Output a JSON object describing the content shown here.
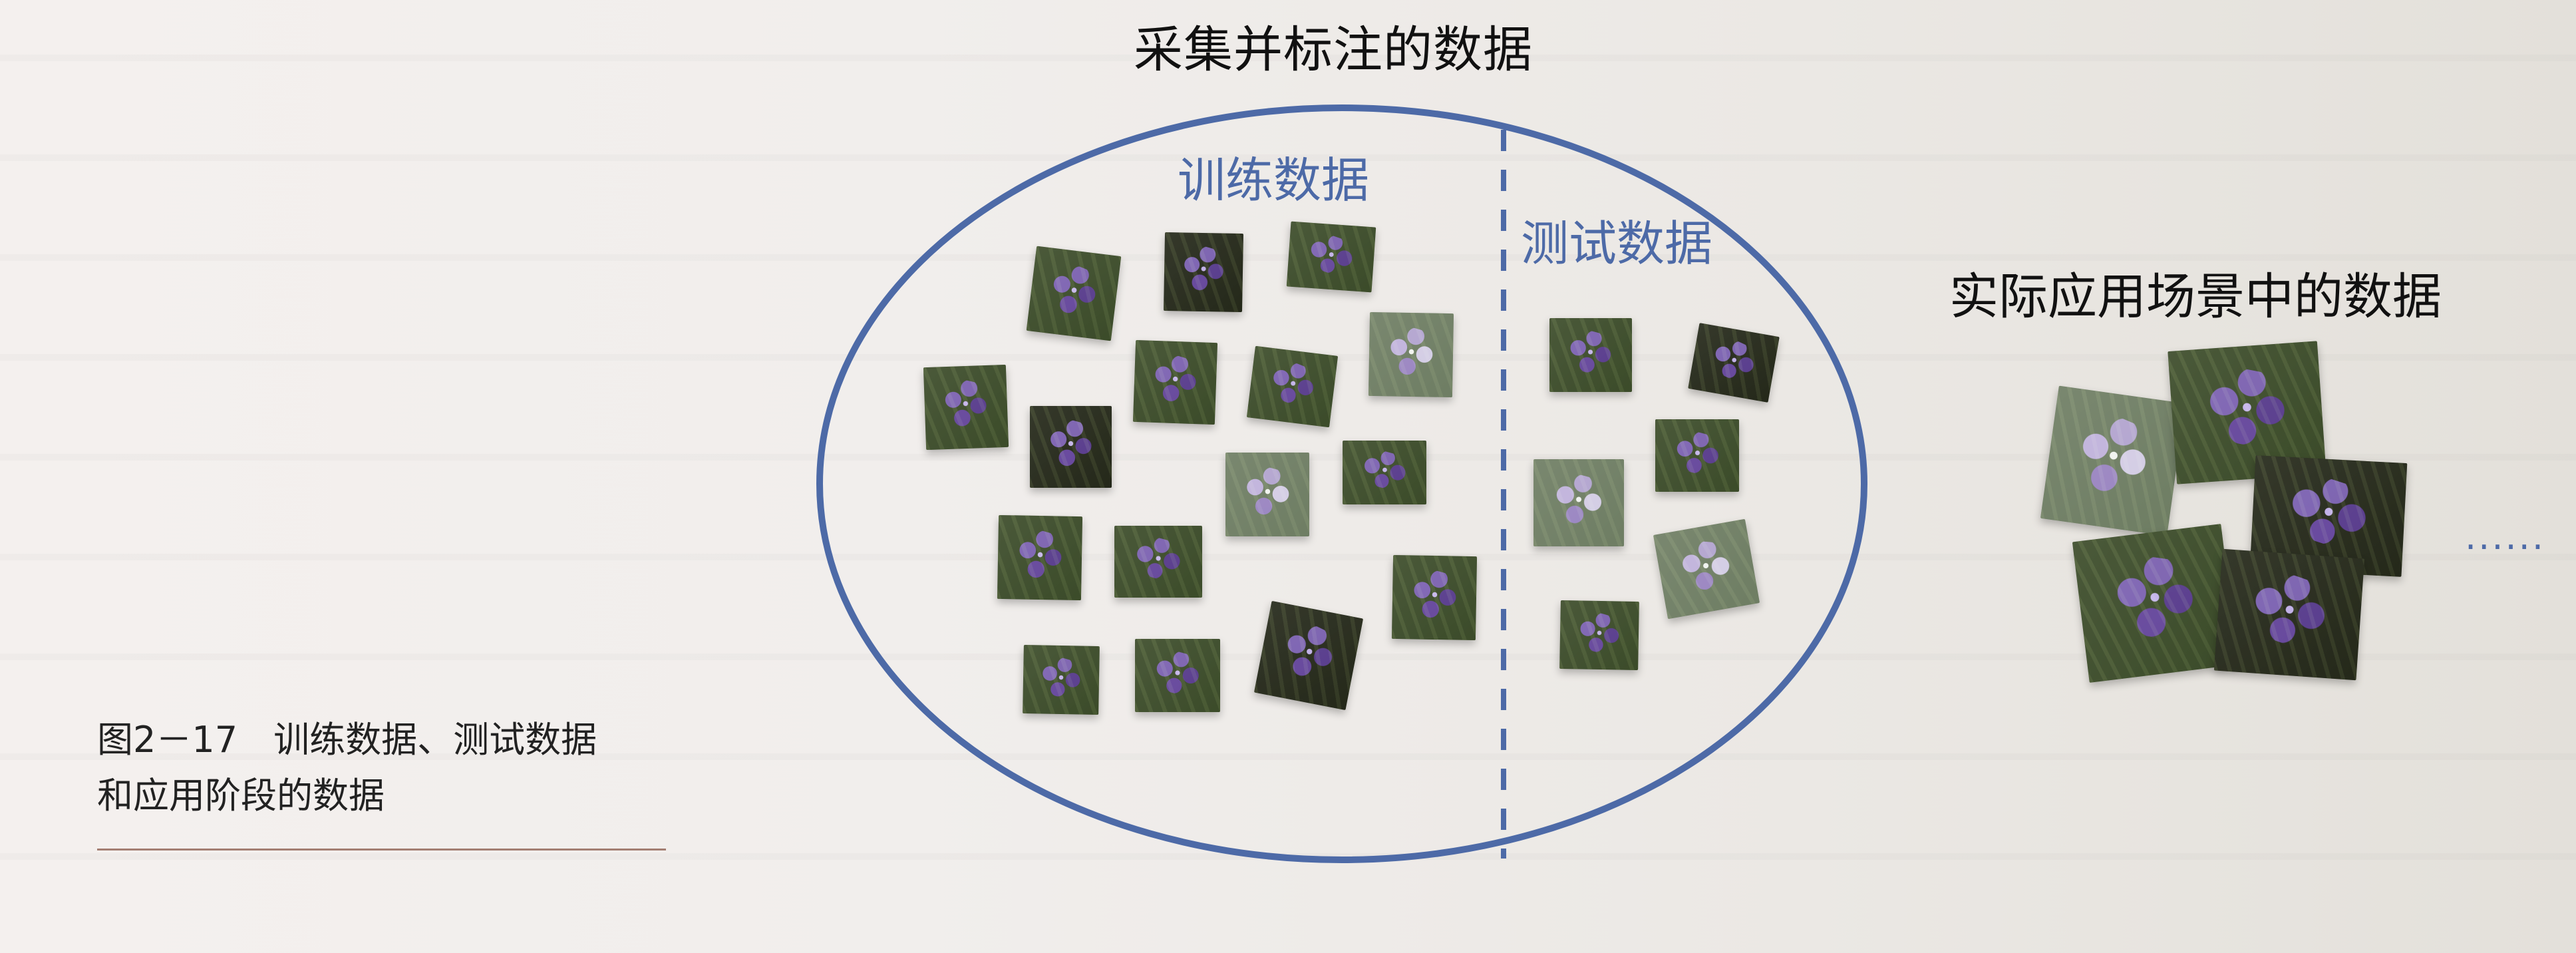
{
  "figure": {
    "title": "采集并标注的数据",
    "train_label": "训练数据",
    "test_label": "测试数据",
    "scene_label": "实际应用场景中的数据",
    "ellipsis": "......",
    "caption_line_1": "图2－17　训练数据、测试数据",
    "caption_line_2": "和应用阶段的数据",
    "colors": {
      "ellipse": "#4d6aa7",
      "caption_rule": "#a37e72"
    },
    "icons": {
      "training_image": "iris-flower-photo-icon",
      "test_image": "iris-flower-photo-icon",
      "scene_image": "iris-flower-photo-icon"
    }
  }
}
